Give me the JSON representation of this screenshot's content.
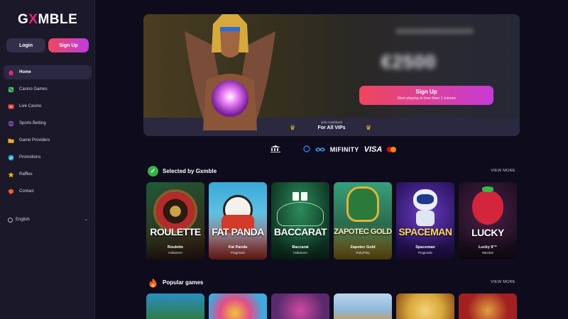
{
  "brand": {
    "logo_left": "G",
    "logo_x": "X",
    "logo_right": "MBLE"
  },
  "auth": {
    "login_label": "Login",
    "signup_label": "Sign Up"
  },
  "nav": {
    "items": [
      {
        "label": "Home",
        "icon": "home-icon",
        "color": "#e6257d"
      },
      {
        "label": "Casino Games",
        "icon": "dice-icon",
        "color": "#3cc46a"
      },
      {
        "label": "Live Casino",
        "icon": "play-icon",
        "color": "#e84545"
      },
      {
        "label": "Sports Betting",
        "icon": "ball-icon",
        "color": "#a55ce6"
      },
      {
        "label": "Game Providers",
        "icon": "folder-icon",
        "color": "#f2b21b"
      },
      {
        "label": "Promotions",
        "icon": "tag-icon",
        "color": "#2fa6e0"
      },
      {
        "label": "Raffles",
        "icon": "star-icon",
        "color": "#f2b21b"
      },
      {
        "label": "Contact",
        "icon": "chat-icon",
        "color": "#f0602d"
      }
    ],
    "language": "English"
  },
  "hero": {
    "signup_title": "Sign Up",
    "signup_subtitle": "Start playing in less than 1 minute",
    "vip_small": "10% Cashback",
    "vip_big": "For All VIPs"
  },
  "payments": {
    "mifinity": "MIFINITY",
    "visa": "VISA"
  },
  "selected": {
    "title": "Selected by Gxmble",
    "view_more": "VIEW MORE",
    "games": [
      {
        "art": "ROULETTE",
        "name": "Roulette",
        "provider": "Habanero",
        "bg": "#1f5a36",
        "bg2": "#3b1d12"
      },
      {
        "art": "FAT PANDA",
        "name": "Fat Panda",
        "provider": "Pragmatic",
        "bg": "#3aa8d8",
        "bg2": "#c33a2f"
      },
      {
        "art": "BACCARAT",
        "name": "Baccarat",
        "provider": "Habanero",
        "bg": "#1b5d3c",
        "bg2": "#0f3a26"
      },
      {
        "art": "ZAPOTEC GOLD",
        "name": "Zapotec Gold",
        "provider": "RubyPlay",
        "bg": "#2d8f6f",
        "bg2": "#a07a1f"
      },
      {
        "art": "SPACEMAN",
        "name": "Spaceman",
        "provider": "Pragmatic",
        "bg": "#3b1e7a",
        "bg2": "#7a2a9e"
      },
      {
        "art": "LUCKY",
        "name": "Lucky 9™",
        "provider": "Wazdan",
        "bg": "#2b1630",
        "bg2": "#d3253b"
      }
    ]
  },
  "popular": {
    "title": "Popular games",
    "view_more": "VIEW MORE",
    "tiles": [
      "#2f7a3c",
      "#3fa9e0",
      "#5a2a6e",
      "#8fb7d8",
      "#d8a83a",
      "#a32020"
    ]
  }
}
